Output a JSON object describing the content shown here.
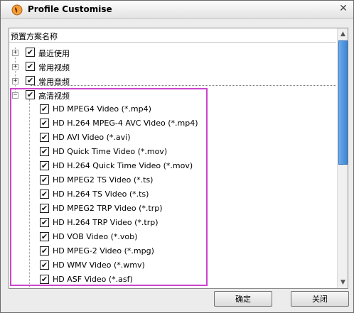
{
  "window": {
    "title": "Profile Customise",
    "close_glyph": "✕"
  },
  "tree": {
    "header": "预置方案名称",
    "groups": [
      {
        "label": "最近使用",
        "expanded": false,
        "checked": true
      },
      {
        "label": "常用视频",
        "expanded": false,
        "checked": true
      },
      {
        "label": "常用音频",
        "expanded": false,
        "checked": true
      },
      {
        "label": "高清视频",
        "expanded": true,
        "checked": true
      }
    ],
    "items": [
      "HD MPEG4 Video (*.mp4)",
      "HD H.264 MPEG-4 AVC Video (*.mp4)",
      "HD AVI Video (*.avi)",
      "HD Quick Time Video (*.mov)",
      "HD H.264 Quick Time Video (*.mov)",
      "HD MPEG2 TS Video (*.ts)",
      "HD H.264 TS Video (*.ts)",
      "HD MPEG2 TRP Video (*.trp)",
      "HD H.264 TRP Video (*.trp)",
      "HD VOB Video (*.vob)",
      "HD MPEG-2 Video (*.mpg)",
      "HD WMV Video (*.wmv)",
      "HD ASF Video (*.asf)"
    ],
    "checkmark": "✔",
    "expand_glyph": "+",
    "collapse_glyph": "−"
  },
  "buttons": {
    "ok": "确定",
    "close": "关闭"
  },
  "colors": {
    "highlight": "#cc44cc",
    "scroll_thumb": "#3d86d8"
  }
}
